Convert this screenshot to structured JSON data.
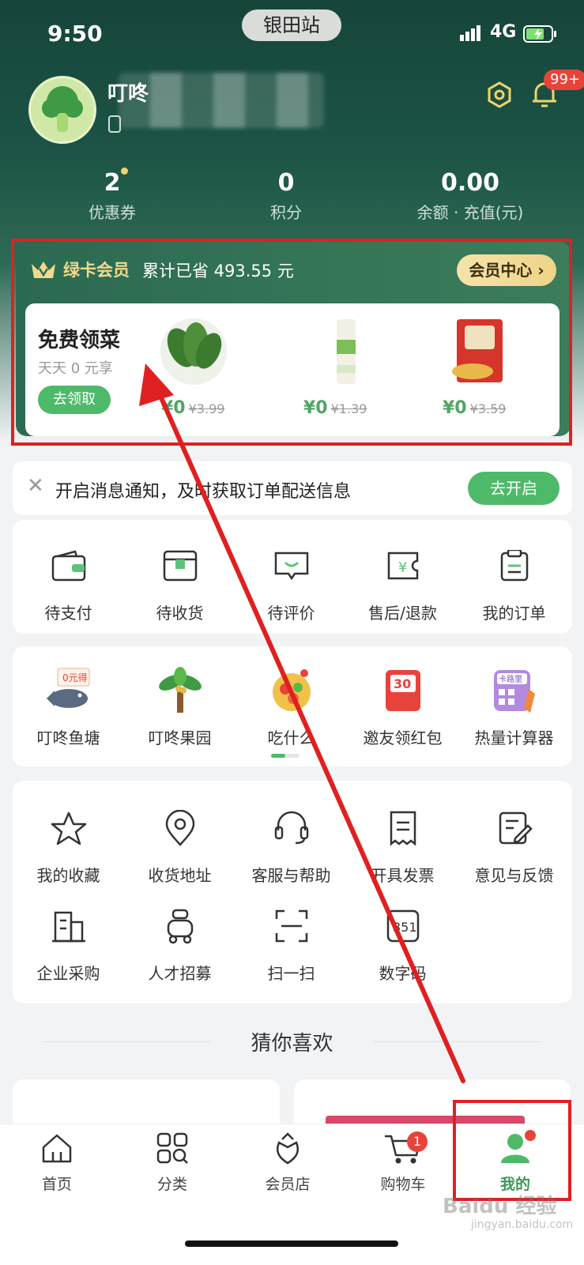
{
  "status_bar": {
    "time": "9:50",
    "station": "银田站",
    "network": "4G"
  },
  "profile": {
    "username": "叮咚",
    "notification_badge": "99+",
    "stats": [
      {
        "value": "2",
        "label": "优惠券"
      },
      {
        "value": "0",
        "label": "积分"
      },
      {
        "value": "0.00",
        "label": "余额 · 充值(元)"
      }
    ]
  },
  "member": {
    "title": "绿卡会员",
    "saved": "累计已省 493.55 元",
    "center_label": "会员中心 ›",
    "free": {
      "title": "免费领菜",
      "subtitle": "天天 0 元享",
      "button": "去领取",
      "products": [
        {
          "price": "¥0",
          "original": "¥3.99"
        },
        {
          "price": "¥0",
          "original": "¥1.39"
        },
        {
          "price": "¥0",
          "original": "¥3.59"
        }
      ]
    }
  },
  "notify": {
    "text": "开启消息通知，及时获取订单配送信息",
    "button": "去开启"
  },
  "orders": [
    {
      "label": "待支付",
      "icon": "wallet-icon"
    },
    {
      "label": "待收货",
      "icon": "package-icon"
    },
    {
      "label": "待评价",
      "icon": "review-icon"
    },
    {
      "label": "售后/退款",
      "icon": "refund-icon"
    },
    {
      "label": "我的订单",
      "icon": "order-list-icon"
    }
  ],
  "features": [
    {
      "label": "叮咚鱼塘",
      "icon": "fish-pond-icon",
      "tag": "0元得"
    },
    {
      "label": "叮咚果园",
      "icon": "orchard-icon"
    },
    {
      "label": "吃什么",
      "icon": "what-to-eat-icon"
    },
    {
      "label": "邀友领红包",
      "icon": "red-packet-icon",
      "tag": "30"
    },
    {
      "label": "热量计算器",
      "icon": "calorie-calculator-icon",
      "tag": "卡路里"
    }
  ],
  "services": [
    {
      "label": "我的收藏",
      "icon": "star-icon"
    },
    {
      "label": "收货地址",
      "icon": "location-pin-icon"
    },
    {
      "label": "客服与帮助",
      "icon": "headset-icon"
    },
    {
      "label": "开具发票",
      "icon": "invoice-icon"
    },
    {
      "label": "意见与反馈",
      "icon": "feedback-icon"
    },
    {
      "label": "企业采购",
      "icon": "building-icon"
    },
    {
      "label": "人才招募",
      "icon": "recruit-icon"
    },
    {
      "label": "扫一扫",
      "icon": "scan-icon"
    },
    {
      "label": "数字码",
      "icon": "digital-code-icon"
    }
  ],
  "guess": {
    "title": "猜你喜欢"
  },
  "tabbar": [
    {
      "label": "首页",
      "icon": "home-icon"
    },
    {
      "label": "分类",
      "icon": "category-icon"
    },
    {
      "label": "会员店",
      "icon": "member-store-icon"
    },
    {
      "label": "购物车",
      "icon": "cart-icon",
      "badge": "1"
    },
    {
      "label": "我的",
      "icon": "profile-icon",
      "active": true
    }
  ],
  "watermark": {
    "main": "Baidu 经验",
    "sub": "jingyan.baidu.com"
  },
  "colors": {
    "brand_green": "#4fb96a",
    "header_dark": "#16453a",
    "annotation_red": "#e02020",
    "badge_red": "#e8433a"
  }
}
